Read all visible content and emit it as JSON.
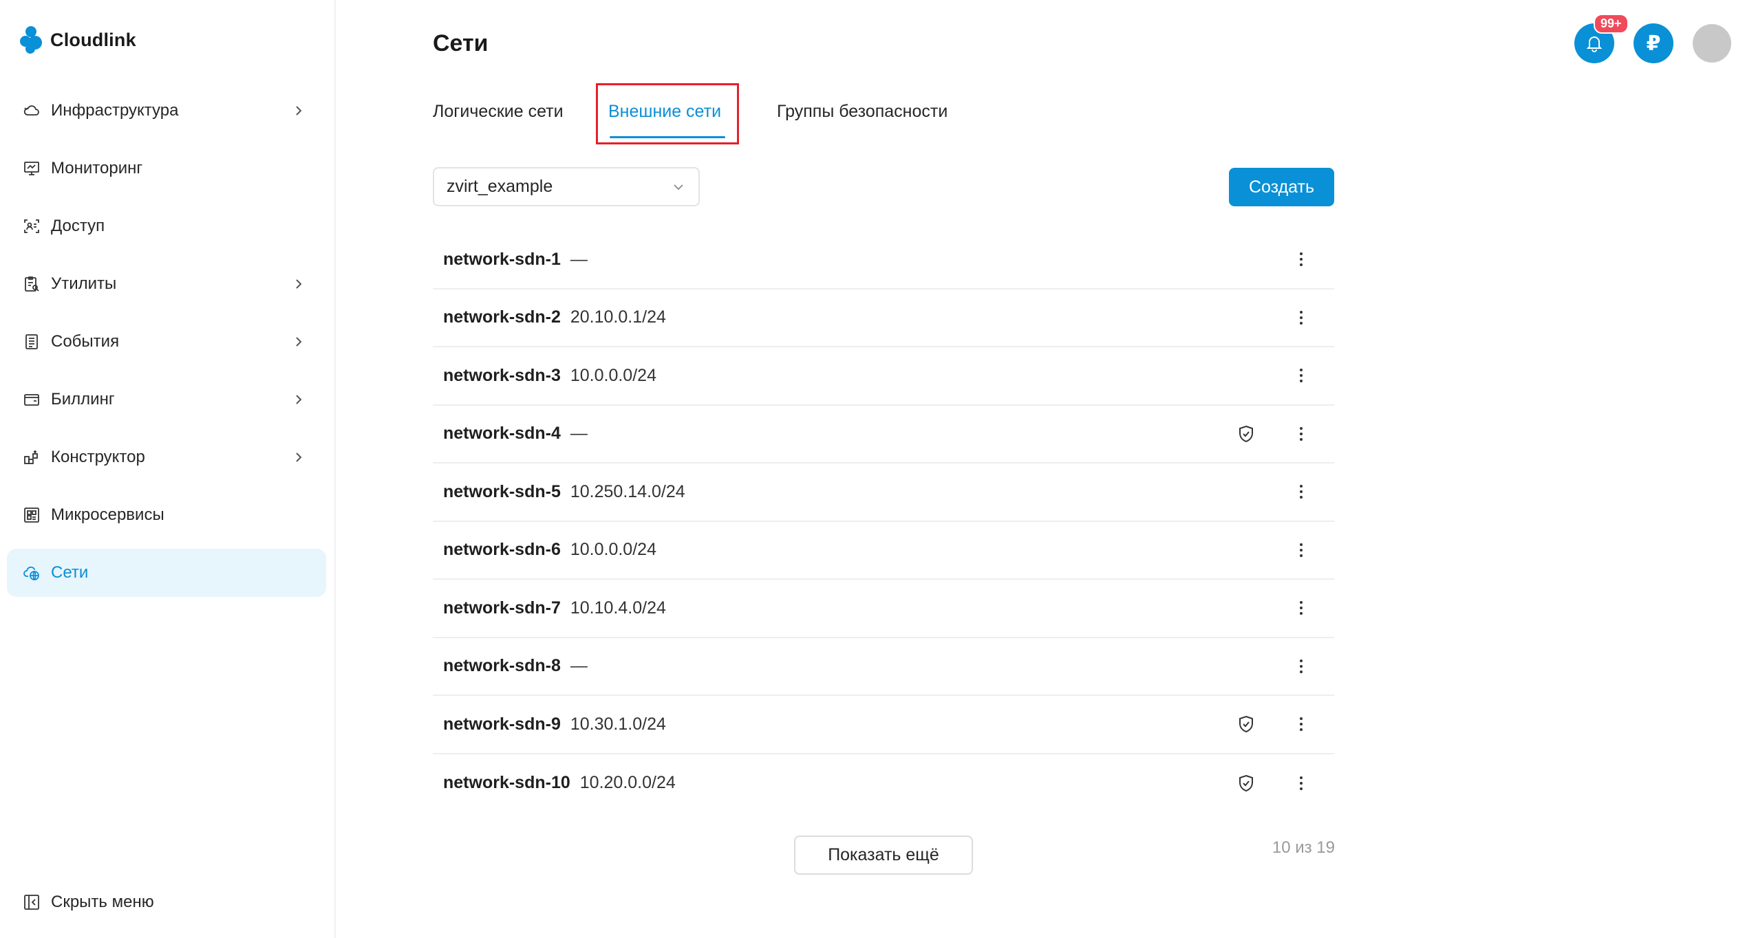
{
  "app": {
    "name": "Cloudlink"
  },
  "sidebar": {
    "items": [
      {
        "label": "Инфраструктура",
        "icon": "cloud-sync-icon",
        "has_children": true,
        "active": false
      },
      {
        "label": "Мониторинг",
        "icon": "monitor-icon",
        "has_children": false,
        "active": false
      },
      {
        "label": "Доступ",
        "icon": "access-icon",
        "has_children": false,
        "active": false
      },
      {
        "label": "Утилиты",
        "icon": "clipboard-icon",
        "has_children": true,
        "active": false
      },
      {
        "label": "События",
        "icon": "document-list-icon",
        "has_children": true,
        "active": false
      },
      {
        "label": "Биллинг",
        "icon": "wallet-icon",
        "has_children": true,
        "active": false
      },
      {
        "label": "Конструктор",
        "icon": "blocks-icon",
        "has_children": true,
        "active": false
      },
      {
        "label": "Микросервисы",
        "icon": "grid-icon",
        "has_children": false,
        "active": false
      },
      {
        "label": "Сети",
        "icon": "cloud-network-icon",
        "has_children": false,
        "active": true
      }
    ],
    "hide_menu_label": "Скрыть меню"
  },
  "header": {
    "title": "Сети",
    "notifications_badge": "99+",
    "currency_symbol": "₽"
  },
  "tabs": [
    {
      "label": "Логические сети",
      "active": false
    },
    {
      "label": "Внешние сети",
      "active": true
    },
    {
      "label": "Группы безопасности",
      "active": false
    }
  ],
  "toolbar": {
    "selected_cluster": "zvirt_example",
    "create_label": "Создать"
  },
  "networks": [
    {
      "name": "network-sdn-1",
      "cidr": "—",
      "protected": false
    },
    {
      "name": "network-sdn-2",
      "cidr": "20.10.0.1/24",
      "protected": false
    },
    {
      "name": "network-sdn-3",
      "cidr": "10.0.0.0/24",
      "protected": false
    },
    {
      "name": "network-sdn-4",
      "cidr": "—",
      "protected": true
    },
    {
      "name": "network-sdn-5",
      "cidr": "10.250.14.0/24",
      "protected": false
    },
    {
      "name": "network-sdn-6",
      "cidr": "10.0.0.0/24",
      "protected": false
    },
    {
      "name": "network-sdn-7",
      "cidr": "10.10.4.0/24",
      "protected": false
    },
    {
      "name": "network-sdn-8",
      "cidr": "—",
      "protected": false
    },
    {
      "name": "network-sdn-9",
      "cidr": "10.30.1.0/24",
      "protected": true
    },
    {
      "name": "network-sdn-10",
      "cidr": "10.20.0.0/24",
      "protected": true
    }
  ],
  "footer": {
    "show_more_label": "Показать ещё",
    "pagination": "10 из 19"
  },
  "colors": {
    "accent": "#0a90d6",
    "active_bg": "#e7f5fd",
    "badge": "#f04a5a",
    "highlight": "#e5202a"
  }
}
